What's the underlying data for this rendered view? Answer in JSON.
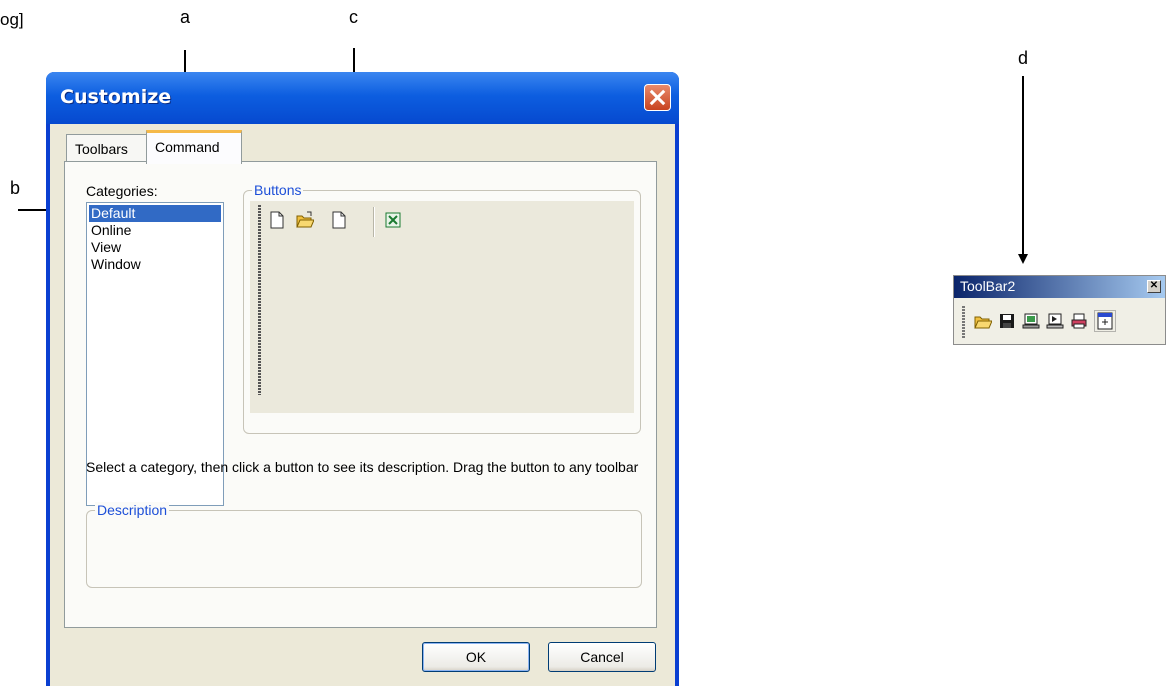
{
  "corner_fragment": "og]",
  "callouts": {
    "a": "a",
    "b": "b",
    "c": "c",
    "d": "d"
  },
  "dialog": {
    "title": "Customize",
    "tabs": [
      {
        "label": "Toolbars"
      },
      {
        "label": "Command"
      }
    ],
    "categories_label": "Categories:",
    "categories": [
      "Default",
      "Online",
      "View",
      "Window"
    ],
    "selected_category": "Default",
    "buttons_group_label": "Buttons",
    "buttons_icons": [
      "new-document-icon",
      "open-folder-icon",
      "blank-document-icon",
      "excel-export-icon"
    ],
    "instruction": "Select a category, then click a button to see its description. Drag the button to any toolbar",
    "description_group_label": "Description",
    "ok_label": "OK",
    "cancel_label": "Cancel"
  },
  "toolbar2": {
    "title": "ToolBar2",
    "icons": [
      "open-folder-icon",
      "save-icon",
      "monitor-icon",
      "print-preview-icon",
      "print-icon",
      "import-icon"
    ]
  },
  "colors": {
    "title_blue": "#0d5ee0",
    "selection": "#316ac5",
    "group_label": "#1d4fd8",
    "close_red": "#c8431f"
  }
}
